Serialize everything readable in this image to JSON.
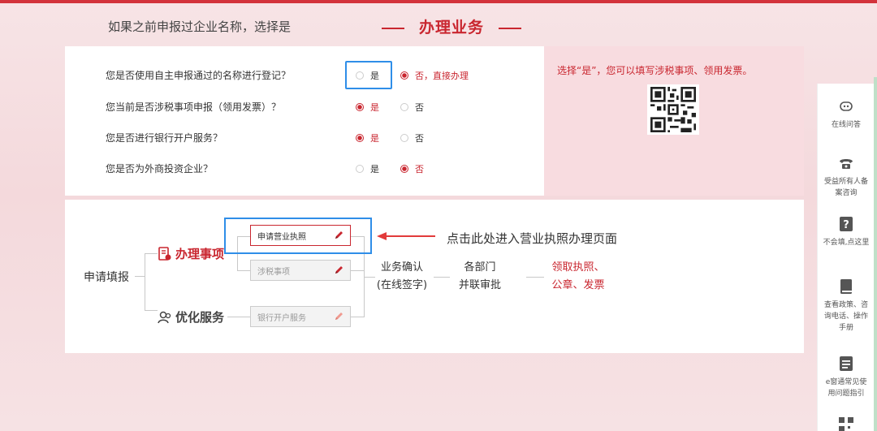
{
  "header": {
    "hint": "如果之前申报过企业名称，选择是",
    "title": "办理业务"
  },
  "questions": [
    {
      "text": "您是否使用自主申报通过的名称进行登记？",
      "yes": "是",
      "no": "否，直接办理",
      "selected": "no"
    },
    {
      "text": "您当前是否涉税事项申报（领用发票）？",
      "yes": "是",
      "no": "否",
      "selected": "yes"
    },
    {
      "text": "您是否进行银行开户服务？",
      "yes": "是",
      "no": "否",
      "selected": "yes"
    },
    {
      "text": "您是否为外商投资企业？",
      "yes": "是",
      "no": "否",
      "selected": "no"
    }
  ],
  "info": {
    "text": "选择“是”，您可以填写涉税事项、领用发票。"
  },
  "process": {
    "root": "申请填报",
    "category1": "办理事项",
    "category2": "优化服务",
    "btn_license": "申请营业执照",
    "btn_tax": "涉税事项",
    "btn_bank": "银行开户服务",
    "hint": "点击此处进入营业执照办理页面",
    "confirm_line1": "业务确认",
    "confirm_line2": "(在线签字)",
    "dept_line1": "各部门",
    "dept_line2": "并联审批",
    "result_line1": "领取执照、",
    "result_line2": "公章、发票"
  },
  "sidebar": {
    "online_qa": "在线问答",
    "beneficiary_line1": "受益所有人备",
    "beneficiary_line2": "案咨询",
    "cant_fill": "不会填,点这里",
    "policy_line1": "查看政策、咨",
    "policy_line2": "询电话、操作",
    "policy_line3": "手册",
    "faq_line1": "e窗通常见使",
    "faq_line2": "用问题指引"
  },
  "colors": {
    "accent": "#c9262f",
    "highlight": "#2f8ee8",
    "panel_pink": "#f8dce0"
  }
}
